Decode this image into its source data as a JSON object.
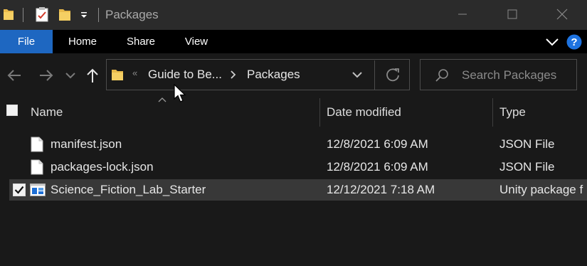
{
  "window": {
    "title": "Packages"
  },
  "ribbon": {
    "tabs": [
      "File",
      "Home",
      "Share",
      "View"
    ],
    "file_tab_color": "#1e67c1"
  },
  "address": {
    "overflow": "«",
    "crumbs": [
      "Guide to Be...",
      "Packages"
    ]
  },
  "search": {
    "placeholder": "Search Packages"
  },
  "columns": {
    "name": "Name",
    "date": "Date modified",
    "type": "Type"
  },
  "files": [
    {
      "name": "manifest.json",
      "date": "12/8/2021 6:09 AM",
      "type": "JSON File",
      "icon": "document-icon",
      "selected": false
    },
    {
      "name": "packages-lock.json",
      "date": "12/8/2021 6:09 AM",
      "type": "JSON File",
      "icon": "document-icon",
      "selected": false
    },
    {
      "name": "Science_Fiction_Lab_Starter",
      "date": "12/12/2021 7:18 AM",
      "type": "Unity package f",
      "icon": "unity-package-icon",
      "selected": true
    }
  ]
}
